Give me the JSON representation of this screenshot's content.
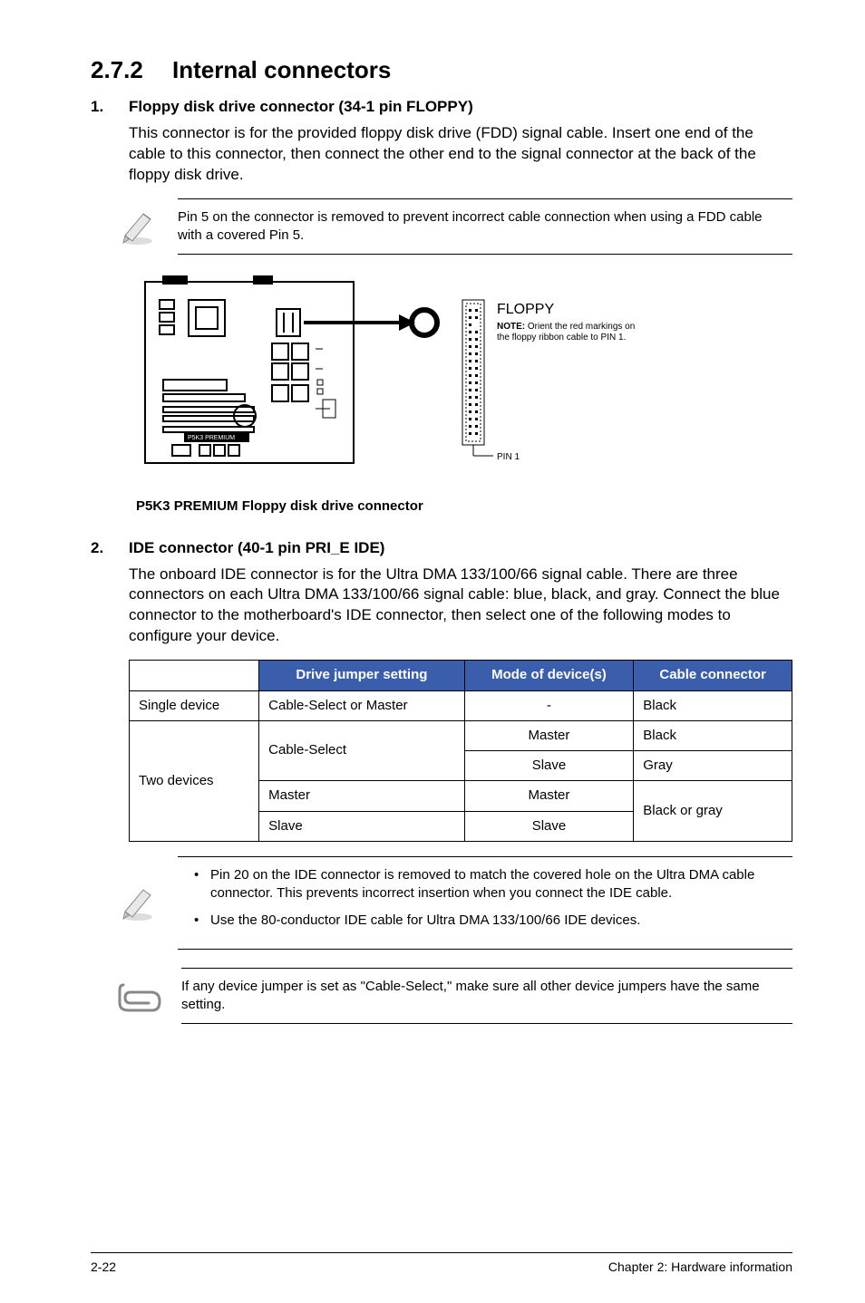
{
  "section": {
    "number": "2.7.2",
    "title": "Internal connectors"
  },
  "item1": {
    "num": "1.",
    "title": "Floppy disk drive connector (34-1 pin FLOPPY)",
    "body": "This connector is for the provided floppy disk drive (FDD) signal cable. Insert one end of the cable to this connector, then connect the other end to the signal connector at the back of the floppy disk drive.",
    "note": "Pin 5 on the connector is removed to prevent incorrect cable connection when using a FDD cable with a covered Pin 5.",
    "fig": {
      "label_floppy": "FLOPPY",
      "note_line1": "NOTE:",
      "note_line2": "Orient the red markings on the floppy ribbon cable to PIN 1.",
      "pin1": "PIN 1",
      "caption": "P5K3 PREMIUM Floppy disk drive connector"
    }
  },
  "item2": {
    "num": "2.",
    "title": "IDE connector (40-1 pin PRI_E IDE)",
    "body": "The onboard IDE connector is for the Ultra DMA 133/100/66 signal cable. There are three connectors on each Ultra DMA 133/100/66 signal cable: blue, black, and gray. Connect the blue connector to the motherboard's IDE connector, then select one of the following modes to configure your device.",
    "table": {
      "headers": [
        "",
        "Drive jumper setting",
        "Mode of device(s)",
        "Cable connector"
      ],
      "rows": [
        [
          "Single device",
          "Cable-Select or Master",
          "-",
          "Black"
        ],
        [
          "Two devices",
          "Cable-Select",
          "Master",
          "Black"
        ],
        [
          "",
          "",
          "Slave",
          "Gray"
        ],
        [
          "",
          "Master",
          "Master",
          "Black or gray"
        ],
        [
          "",
          "Slave",
          "Slave",
          ""
        ]
      ]
    },
    "bullets": [
      "Pin 20 on the IDE connector is removed to match the covered hole on the Ultra DMA cable connector. This prevents incorrect insertion when you connect the IDE cable.",
      "Use the 80-conductor IDE cable for Ultra DMA 133/100/66 IDE devices."
    ],
    "final_note": "If any device jumper is set as \"Cable-Select,\" make sure all other device jumpers have the same setting."
  },
  "footer": {
    "left": "2-22",
    "right": "Chapter 2: Hardware information"
  }
}
